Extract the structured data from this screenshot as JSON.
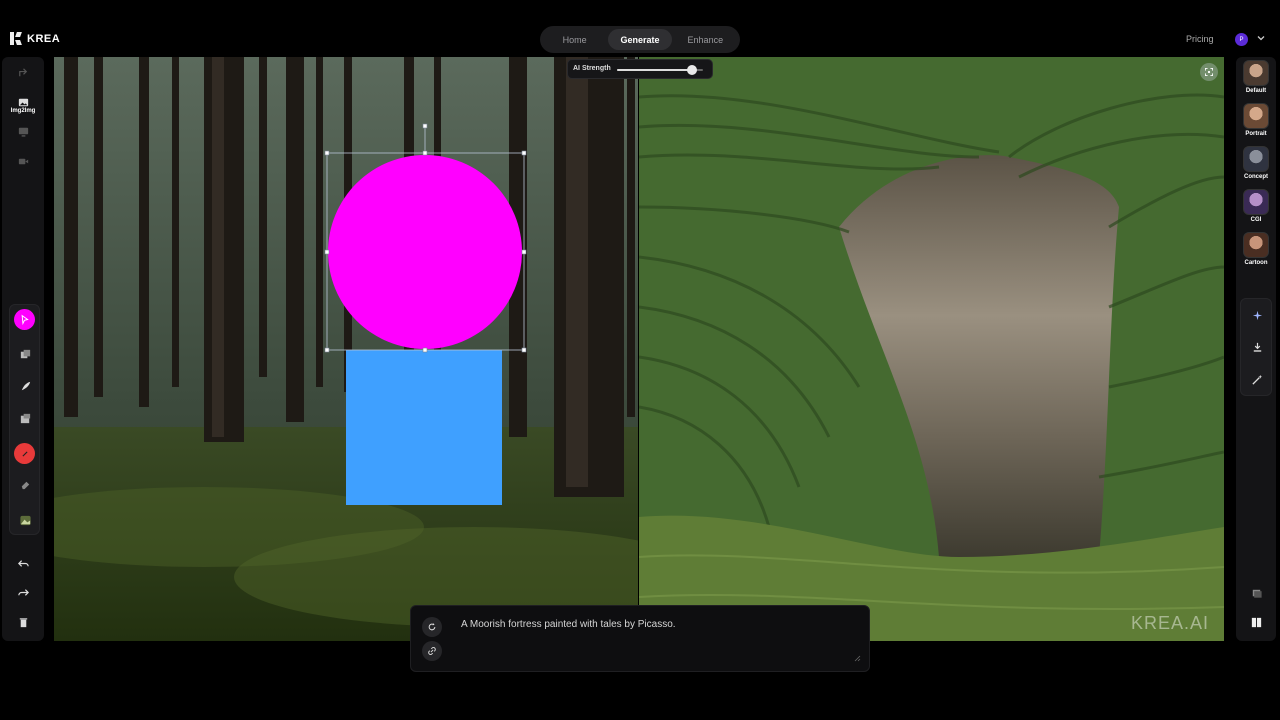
{
  "brand": {
    "name": "KREA"
  },
  "nav": {
    "tabs": [
      {
        "label": "Home"
      },
      {
        "label": "Generate"
      },
      {
        "label": "Enhance"
      }
    ],
    "active": "Generate"
  },
  "header": {
    "pricing_label": "Pricing",
    "avatar_initial": "P"
  },
  "left_toolbar": {
    "img2img_label": "Img2Img"
  },
  "ai_strength": {
    "label": "AI Strength",
    "value": 0.87
  },
  "styles": [
    {
      "label": "Default"
    },
    {
      "label": "Portrait"
    },
    {
      "label": "Concept"
    },
    {
      "label": "CGI"
    },
    {
      "label": "Cartoon"
    }
  ],
  "prompt": {
    "text": "A Moorish fortress painted with tales by Picasso."
  },
  "watermark": "KREA.AI",
  "colors": {
    "accent_magenta": "#ff00ff",
    "shape_blue": "#3fa0ff",
    "tool_red": "#e83a3a"
  },
  "icons": [
    "share-icon",
    "image-icon",
    "screen-icon",
    "video-icon",
    "select-icon",
    "duplicate-icon",
    "pen-icon",
    "images-icon",
    "color-picker-icon",
    "eraser-icon",
    "landscape-icon",
    "undo-icon",
    "redo-icon",
    "trash-icon",
    "focus-icon",
    "sparkle-icon",
    "download-icon",
    "enhance-icon",
    "layers-icon",
    "split-view-icon",
    "refresh-icon",
    "link-icon"
  ]
}
